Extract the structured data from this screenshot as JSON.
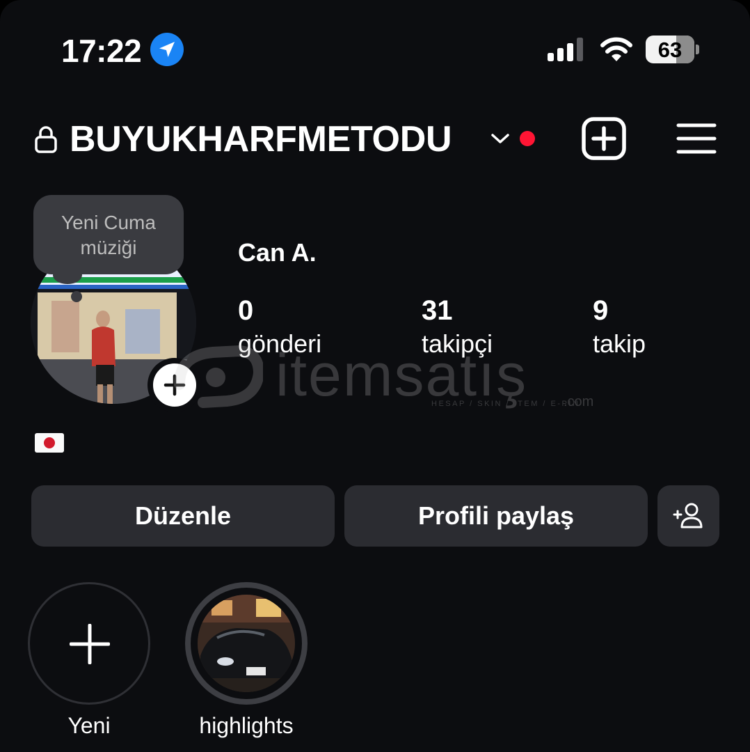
{
  "status_bar": {
    "time": "17:22",
    "battery": "63",
    "battery_level_percent": 63,
    "icons": [
      "location-arrow-icon",
      "cellular-signal-icon",
      "wifi-icon",
      "battery-icon"
    ]
  },
  "header": {
    "username": "BUYUKHARFMETODU",
    "icons": [
      "lock-icon",
      "chevron-down-icon",
      "notification-dot",
      "create-plus-icon",
      "hamburger-menu-icon"
    ],
    "accent_color": "#ff1534"
  },
  "note": {
    "text_line1": "Yeni Cuma",
    "text_line2": "müziği"
  },
  "profile": {
    "display_name": "Can A.",
    "stats": [
      {
        "value": "0",
        "label": "gönderi"
      },
      {
        "value": "31",
        "label": "takipçi"
      },
      {
        "value": "9",
        "label": "takip"
      }
    ],
    "bio_emoji": "flag-japan"
  },
  "watermark": {
    "brand": "itemsatış",
    "tagline": "HESAP / SKIN / ITEM / E-PIN",
    "domain": ".com"
  },
  "actions": {
    "edit_label": "Düzenle",
    "share_label": "Profili paylaş",
    "add_user_icon": "add-person-icon"
  },
  "highlights": [
    {
      "label": "Yeni",
      "icon": "plus-icon"
    },
    {
      "label": "highlights",
      "icon": "car-photo"
    }
  ],
  "colors": {
    "background": "#0c0d10",
    "button": "#2b2c31",
    "location_blue": "#1a84f5"
  }
}
